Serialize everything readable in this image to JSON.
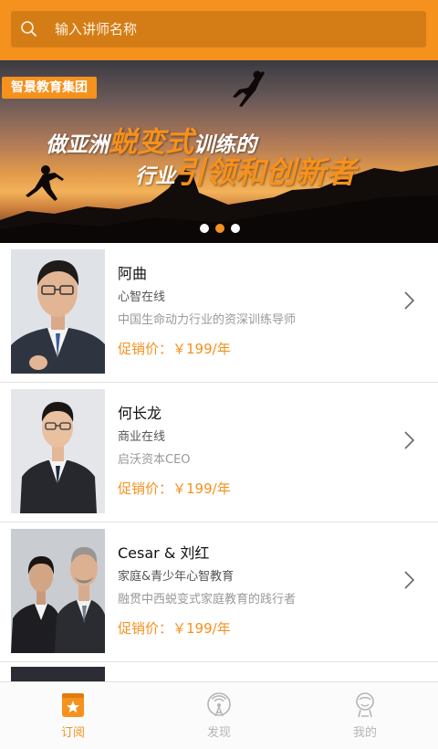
{
  "search": {
    "placeholder": "输入讲师名称"
  },
  "banner": {
    "tag": "智景教育集团",
    "slogan_line1_pre": "做亚洲",
    "slogan_line1_big": "蜕变式",
    "slogan_line1_post": "训练的",
    "slogan_line2_pre": "行业",
    "slogan_line2_big": "引领和创新者",
    "slides": 3,
    "active_slide": 2
  },
  "teachers": [
    {
      "name": "阿曲",
      "category": "心智在线",
      "description": "中国生命动力行业的资深训练导师",
      "price_label": "促销价：",
      "price": "￥199/年"
    },
    {
      "name": "何长龙",
      "category": "商业在线",
      "description": "启沃资本CEO",
      "price_label": "促销价：",
      "price": "￥199/年"
    },
    {
      "name": "Cesar & 刘红",
      "category": "家庭&青少年心智教育",
      "description": "融贯中西蜕变式家庭教育的践行者",
      "price_label": "促销价：",
      "price": "￥199/年"
    }
  ],
  "tabs": [
    {
      "label": "订阅",
      "icon": "subscribe-star-icon",
      "active": true
    },
    {
      "label": "发现",
      "icon": "discover-radio-icon",
      "active": false
    },
    {
      "label": "我的",
      "icon": "profile-person-icon",
      "active": false
    }
  ],
  "colors": {
    "accent": "#f5911d",
    "search_bg": "#d47d17",
    "tab_inactive": "#b5b5b5"
  }
}
